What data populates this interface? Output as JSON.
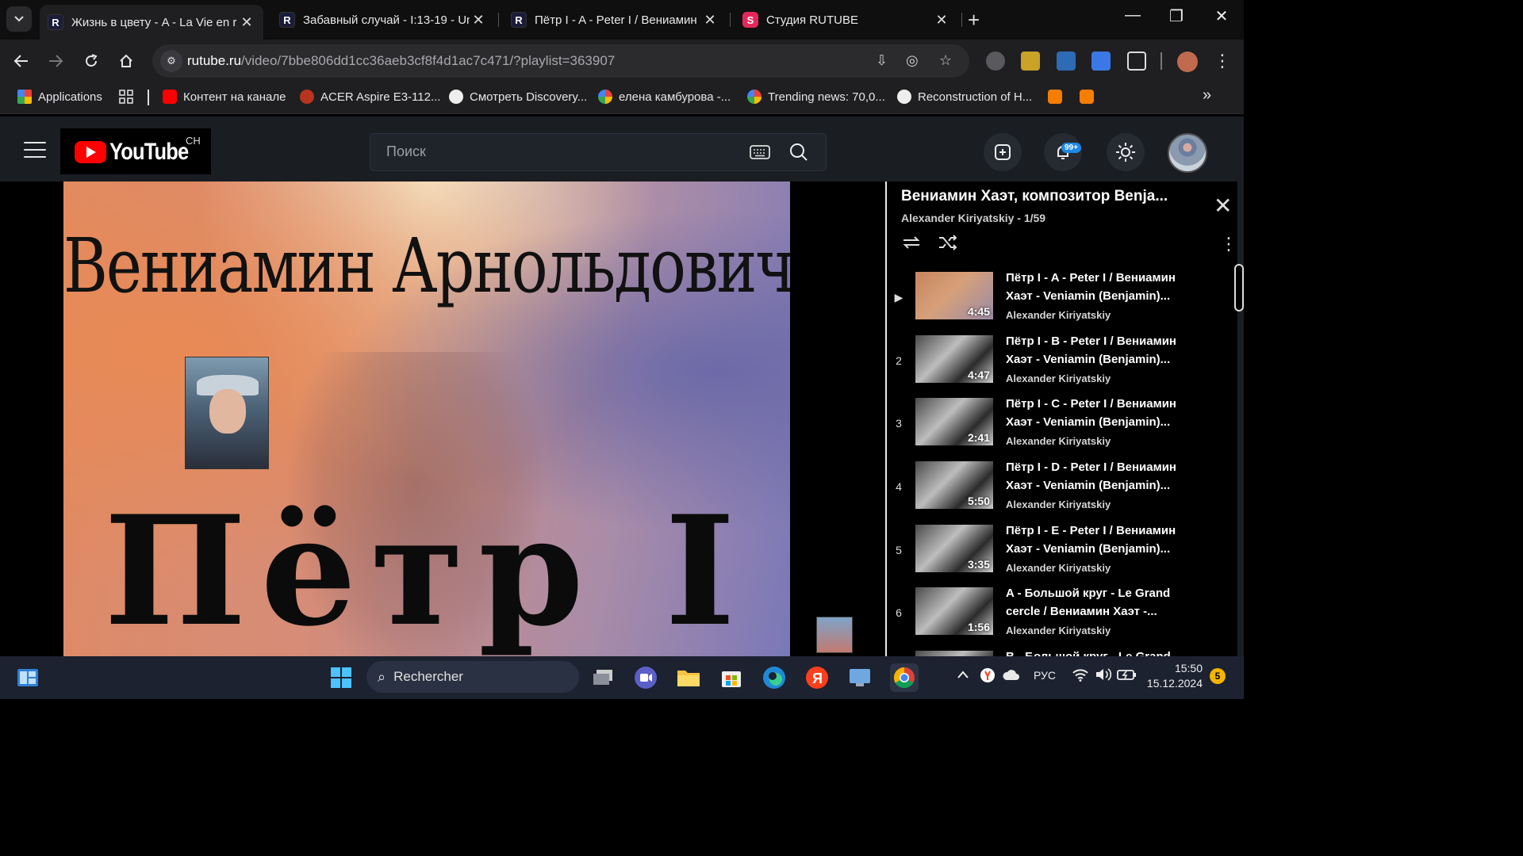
{
  "browser": {
    "tabs": [
      {
        "label": "Жизнь в цвету - A - La Vie en r",
        "favicon": "R",
        "active": true
      },
      {
        "label": "Забавный случай - I:13-19 - Un",
        "favicon": "R",
        "active": false
      },
      {
        "label": "Пётр I - A - Peter I / Вениамин",
        "favicon": "R",
        "active": false
      },
      {
        "label": "Студия RUTUBE",
        "favicon": "S",
        "active": false
      }
    ],
    "url_host": "rutube.ru",
    "url_path": "/video/7bbe806dd1cc36aeb3cf8f4d1ac7c471/?playlist=363907",
    "bookmarks": [
      {
        "label": "Applications"
      },
      {
        "label": "Контент на канале"
      },
      {
        "label": "ACER Aspire E3-112..."
      },
      {
        "label": "Смотреть Discovery..."
      },
      {
        "label": "елена камбурова -..."
      },
      {
        "label": "Trending news: 70,0..."
      },
      {
        "label": "Reconstruction of H..."
      }
    ],
    "more_bookmarks": "»"
  },
  "site": {
    "logo_text": "YouTube",
    "logo_region": "CH",
    "search_placeholder": "Поиск",
    "notification_badge": "99+"
  },
  "video": {
    "overlay_title": "Вениамин Арнольдович Хаэт",
    "overlay_big_title": "Пётр I"
  },
  "playlist": {
    "title": "Вениамин Хаэт, композитор Benja...",
    "subtitle": "Alexander Kiriyatskiy - 1/59",
    "items": [
      {
        "index": "▶",
        "title": "Пётр I - A - Peter I / Вениамин Хаэт - Veniamin (Benjamin)...",
        "author": "Alexander Kiriyatskiy",
        "duration": "4:45"
      },
      {
        "index": "2",
        "title": "Пётр I - B - Peter I / Вениамин Хаэт - Veniamin (Benjamin)...",
        "author": "Alexander Kiriyatskiy",
        "duration": "4:47"
      },
      {
        "index": "3",
        "title": "Пётр I - C - Peter I / Вениамин Хаэт - Veniamin (Benjamin)...",
        "author": "Alexander Kiriyatskiy",
        "duration": "2:41"
      },
      {
        "index": "4",
        "title": "Пётр I - D - Peter I / Вениамин Хаэт - Veniamin (Benjamin)...",
        "author": "Alexander Kiriyatskiy",
        "duration": "5:50"
      },
      {
        "index": "5",
        "title": "Пётр I - E - Peter I / Вениамин Хаэт - Veniamin (Benjamin)...",
        "author": "Alexander Kiriyatskiy",
        "duration": "3:35"
      },
      {
        "index": "6",
        "title": "A - Большой круг - Le Grand cercle / Вениамин Хаэт -...",
        "author": "Alexander Kiriyatskiy",
        "duration": "1:56"
      },
      {
        "index": "7",
        "title": "B - Большой круг - Le Grand",
        "author": "",
        "duration": ""
      }
    ]
  },
  "taskbar": {
    "search_label": "Rechercher",
    "language": "РУС",
    "time": "15:50",
    "date": "15.12.2024",
    "notification_count": "5"
  },
  "colors": {
    "accent_red": "#ff0000",
    "rutube_pink": "#e5285b",
    "badge_blue": "#1e88e5"
  }
}
